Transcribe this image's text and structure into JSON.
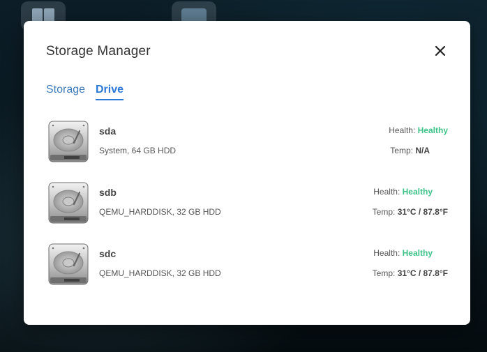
{
  "dialog": {
    "title": "Storage Manager"
  },
  "tabs": [
    {
      "label": "Storage",
      "active": false
    },
    {
      "label": "Drive",
      "active": true
    }
  ],
  "drives": [
    {
      "name": "sda",
      "description": "System, 64 GB HDD",
      "health_label": "Health:",
      "health_value": "Healthy",
      "temp_label": "Temp:",
      "temp_value": "N/A"
    },
    {
      "name": "sdb",
      "description": "QEMU_HARDDISK, 32 GB HDD",
      "health_label": "Health:",
      "health_value": "Healthy",
      "temp_label": "Temp:",
      "temp_value": "31°C / 87.8°F"
    },
    {
      "name": "sdc",
      "description": "QEMU_HARDDISK, 32 GB HDD",
      "health_label": "Health:",
      "health_value": "Healthy",
      "temp_label": "Temp:",
      "temp_value": "31°C / 87.8°F"
    }
  ],
  "colors": {
    "accent": "#2b78d6",
    "healthy": "#3ec489"
  },
  "icons": {
    "close": "close-icon",
    "drive": "hard-disk-icon"
  }
}
